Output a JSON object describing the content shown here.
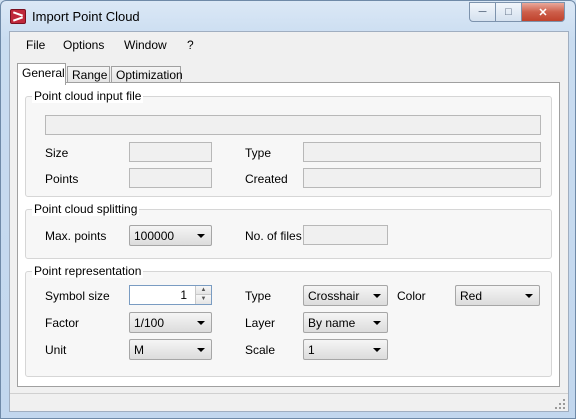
{
  "window": {
    "title": "Import Point Cloud"
  },
  "menu": [
    "File",
    "Options",
    "Window",
    "?"
  ],
  "tabs": [
    "General",
    "Range",
    "Optimization"
  ],
  "input_group": {
    "title": "Point cloud input file",
    "file_value": "",
    "size_label": "Size",
    "size_value": "",
    "type_label": "Type",
    "type_value": "",
    "points_label": "Points",
    "points_value": "",
    "created_label": "Created",
    "created_value": ""
  },
  "splitting_group": {
    "title": "Point cloud splitting",
    "max_points_label": "Max. points",
    "max_points_value": "100000",
    "num_files_label": "No. of files",
    "num_files_value": ""
  },
  "representation_group": {
    "title": "Point representation",
    "symbol_size_label": "Symbol size",
    "symbol_size_value": "1",
    "type_label": "Type",
    "type_value": "Crosshair",
    "color_label": "Color",
    "color_value": "Red",
    "factor_label": "Factor",
    "factor_value": "1/100",
    "layer_label": "Layer",
    "layer_value": "By name",
    "unit_label": "Unit",
    "unit_value": "M",
    "scale_label": "Scale",
    "scale_value": "1"
  }
}
